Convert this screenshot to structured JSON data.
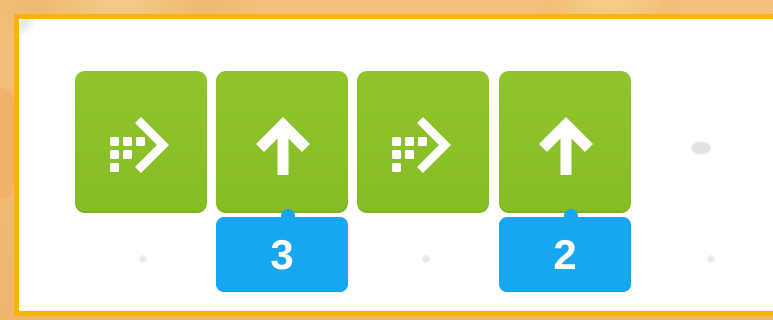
{
  "program": {
    "blocks": [
      {
        "type": "turn-right",
        "icon": "turn-right-icon"
      },
      {
        "type": "move-forward",
        "icon": "up-arrow-icon",
        "count": "3"
      },
      {
        "type": "turn-right",
        "icon": "turn-right-icon"
      },
      {
        "type": "move-forward",
        "icon": "up-arrow-icon",
        "count": "2"
      }
    ]
  },
  "colors": {
    "block_green": "#8fc42c",
    "badge_blue": "#16a7f0",
    "panel_border": "#f8b400",
    "background": "#f0bf7d"
  }
}
